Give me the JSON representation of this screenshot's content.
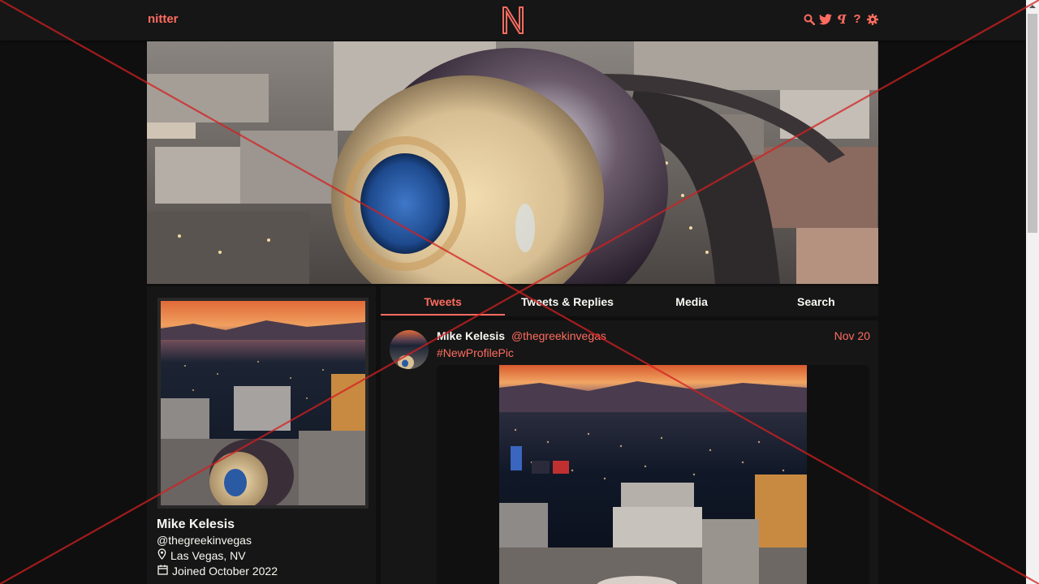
{
  "navbar": {
    "brand": "nitter",
    "logo_letter": "N",
    "icons": [
      {
        "name": "search-icon"
      },
      {
        "name": "twitter-bird-icon"
      },
      {
        "name": "rss-icon",
        "glyph": "ꟼ"
      },
      {
        "name": "help-icon",
        "glyph": "?"
      },
      {
        "name": "gear-icon"
      }
    ]
  },
  "profile": {
    "fullname": "Mike Kelesis",
    "username": "@thegreekinvegas",
    "location": "Las Vegas, NV",
    "joined": "Joined October 2022"
  },
  "tabs": [
    {
      "label": "Tweets",
      "active": true
    },
    {
      "label": "Tweets & Replies",
      "active": false
    },
    {
      "label": "Media",
      "active": false
    },
    {
      "label": "Search",
      "active": false
    }
  ],
  "tweet": {
    "fullname": "Mike Kelesis",
    "username": "@thegreekinvegas",
    "date": "Nov 20",
    "text": "#NewProfilePic"
  },
  "colors": {
    "accent": "#ff6c60",
    "background": "#0f0f0f",
    "panel": "#161616",
    "text": "#f8f8f2",
    "overlay_x": "#d32020"
  }
}
